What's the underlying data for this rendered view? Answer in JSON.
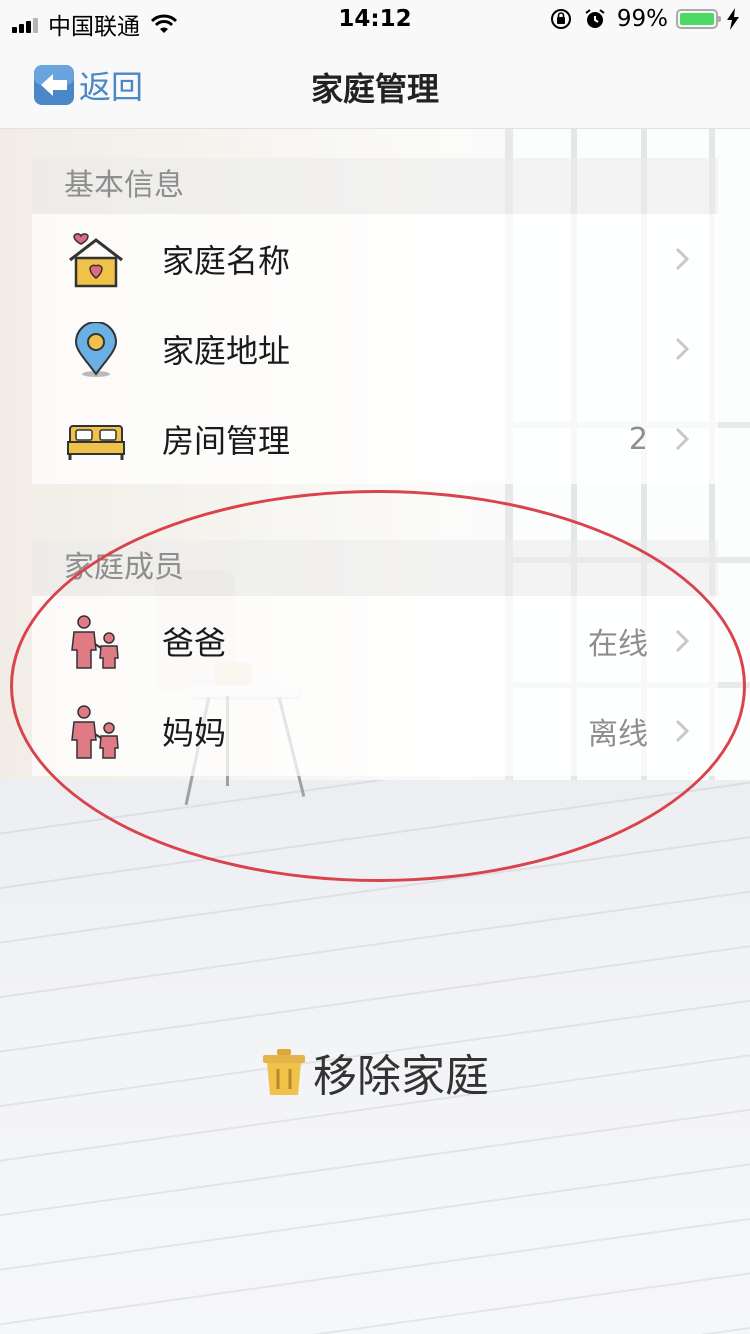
{
  "status_bar": {
    "carrier": "中国联通",
    "time": "14:12",
    "battery": "99%",
    "battery_level": 0.99,
    "battery_color": "#4cd964"
  },
  "nav": {
    "back_label": "返回",
    "title": "家庭管理",
    "back_icon": "back-arrow-icon"
  },
  "basic_info": {
    "header": "基本信息",
    "items": [
      {
        "label": "家庭名称",
        "value": "",
        "icon": "house-heart-icon"
      },
      {
        "label": "家庭地址",
        "value": "",
        "icon": "location-pin-icon"
      },
      {
        "label": "房间管理",
        "value": "2",
        "icon": "bed-icon"
      }
    ]
  },
  "members": {
    "header": "家庭成员",
    "items": [
      {
        "label": "爸爸",
        "value": "在线",
        "icon": "parent-child-icon"
      },
      {
        "label": "妈妈",
        "value": "离线",
        "icon": "parent-child-icon"
      }
    ]
  },
  "remove": {
    "label": "移除家庭",
    "icon": "trash-icon"
  },
  "colors": {
    "accent": "#4a87c6",
    "annotation": "#d9434b",
    "member_icon": "#e07b86",
    "house_icon": "#f1c24a"
  }
}
